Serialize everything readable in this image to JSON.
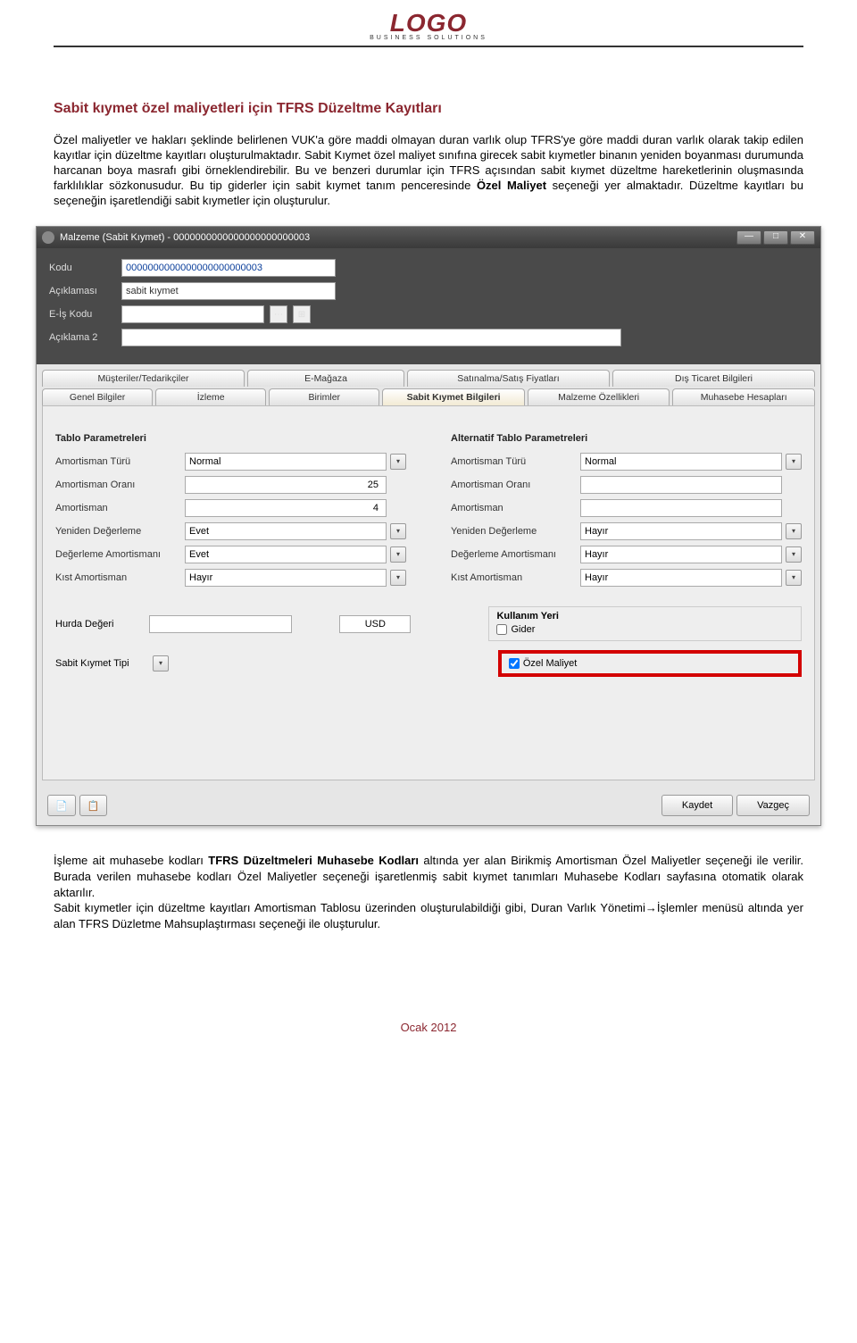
{
  "logo": {
    "main": "LOGO",
    "sub": "BUSINESS  SOLUTIONS"
  },
  "title": "Sabit kıymet özel maliyetleri için TFRS Düzeltme Kayıtları",
  "body_p1_a": "Özel maliyetler ve hakları şeklinde belirlenen VUK'a göre maddi olmayan duran varlık olup TFRS'ye göre maddi duran varlık olarak takip edilen kayıtlar için düzeltme kayıtları oluşturulmaktadır. Sabit Kıymet özel maliyet sınıfına girecek sabit kıymetler binanın yeniden boyanması durumunda harcanan boya masrafı gibi örneklendirebilir. Bu ve benzeri durumlar için TFRS açısından sabit kıymet düzeltme hareketlerinin oluşmasında farklılıklar sözkonusudur. Bu tip giderler için sabit kıymet tanım penceresinde ",
  "body_p1_bold": "Özel Maliyet",
  "body_p1_b": " seçeneği yer almaktadır. Düzeltme kayıtları bu seçeneğin işaretlendiği sabit kıymetler için oluşturulur.",
  "window": {
    "title": "Malzeme (Sabit Kıymet) - 0000000000000000000000003",
    "minimize": "—",
    "restore": "□",
    "close": "✕"
  },
  "form": {
    "kodu_label": "Kodu",
    "kodu_value": "0000000000000000000000003",
    "aciklama_label": "Açıklaması",
    "aciklama_value": "sabit kıymet",
    "eis_label": "E-İş Kodu",
    "aciklama2_label": "Açıklama 2"
  },
  "tabs_top": [
    "Müşteriler/Tedarikçiler",
    "E-Mağaza",
    "Satınalma/Satış Fiyatları",
    "Dış Ticaret Bilgileri"
  ],
  "tabs_bottom": [
    "Genel Bilgiler",
    "İzleme",
    "Birimler",
    "Sabit Kıymet Bilgileri",
    "Malzeme Özellikleri",
    "Muhasebe Hesapları"
  ],
  "params": {
    "h1": "Tablo Parametreleri",
    "h2": "Alternatif Tablo Parametreleri",
    "rows": [
      {
        "label": "Amortisman Türü",
        "v1": "Normal",
        "v2": "Normal",
        "type": "select"
      },
      {
        "label": "Amortisman Oranı",
        "v1": "25",
        "v2": "",
        "type": "num"
      },
      {
        "label": "Amortisman",
        "v1": "4",
        "v2": "",
        "type": "num"
      },
      {
        "label": "Yeniden Değerleme",
        "v1": "Evet",
        "v2": "Hayır",
        "type": "select"
      },
      {
        "label": "Değerleme Amortismanı",
        "v1": "Evet",
        "v2": "Hayır",
        "type": "select"
      },
      {
        "label": "Kıst Amortisman",
        "v1": "Hayır",
        "v2": "Hayır",
        "type": "select"
      }
    ]
  },
  "extras": {
    "hurda_label": "Hurda Değeri",
    "usd": "USD",
    "sabit_tip_label": "Sabit Kıymet Tipi",
    "kullanim_head": "Kullanım Yeri",
    "gider_label": "Gider",
    "ozel_label": "Özel Maliyet"
  },
  "buttons": {
    "save": "Kaydet",
    "cancel": "Vazgeç"
  },
  "footer_p": {
    "a": "İşleme ait muhasebe kodları ",
    "b_bold": "TFRS Düzeltmeleri Muhasebe Kodları",
    "c": " altında yer alan Birikmiş Amortisman Özel Maliyetler seçeneği ile verilir. Burada verilen muhasebe kodları Özel Maliyetler seçeneği işaretlenmiş sabit kıymet tanımları Muhasebe Kodları sayfasına otomatik olarak aktarılır.",
    "d": "Sabit kıymetler için düzeltme kayıtları Amortisman Tablosu üzerinden oluşturulabildiği gibi, Duran Varlık Yönetimi→İşlemler menüsü altında yer alan TFRS Düzletme Mahsuplaştırması seçeneği ile oluşturulur."
  },
  "page_footer": "Ocak 2012"
}
